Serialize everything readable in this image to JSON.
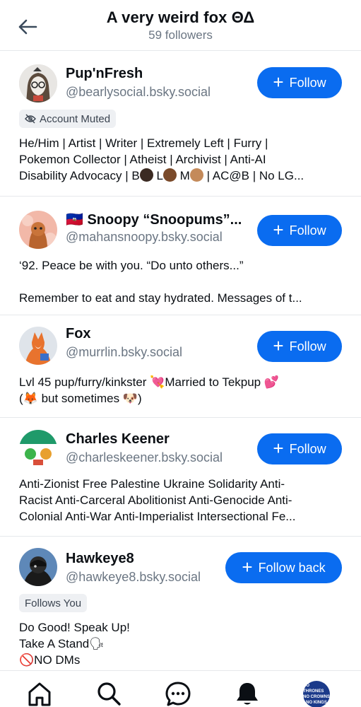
{
  "header": {
    "title": "A very weird fox ΘΔ",
    "subtitle": "59 followers"
  },
  "users": [
    {
      "name": "Pup'nFresh",
      "handle": "@bearlysocial.bsky.social",
      "button": "Follow",
      "badge": "Account Muted",
      "bio_lines": [
        "He/Him | Artist | Writer | Extremely Left | Furry |",
        "Pokemon Collector | Atheist | Archivist | Anti-AI",
        "Disability Advocacy | B",
        "L",
        "M",
        "| AC@B | No LG..."
      ]
    },
    {
      "flag": "🇭🇹",
      "name": "Snoopy “Snoopums”...",
      "handle": "@mahansnoopy.bsky.social",
      "button": "Follow",
      "bio_lines": [
        "‘92. Peace be with you. “Do unto others...”",
        "Remember to eat and stay hydrated. Messages of t..."
      ]
    },
    {
      "name": "Fox",
      "handle": "@murrlin.bsky.social",
      "button": "Follow",
      "bio_lines": [
        "Lvl 45 pup/furry/kinkster",
        "Married to Tekpup",
        "(",
        "but sometimes",
        ")"
      ],
      "emoji": {
        "heart_arrow": "💘",
        "hearts": "💕",
        "fox": "🦊",
        "dog": "🐶"
      }
    },
    {
      "name": "Charles Keener",
      "handle": "@charleskeener.bsky.social",
      "button": "Follow",
      "bio_lines": [
        "Anti-Zionist Free Palestine Ukraine Solidarity Anti-",
        "Racist Anti-Carceral Abolitionist Anti-Genocide Anti-",
        "Colonial Anti-War Anti-Imperialist Intersectional Fe..."
      ]
    },
    {
      "name": "Hawkeye8",
      "handle": "@hawkeye8.bsky.social",
      "button": "Follow back",
      "badge": "Follows You",
      "bio_lines": [
        "Do Good! Speak Up!",
        "Take A Stand",
        "NO DMs"
      ],
      "emoji": {
        "speaking": "🗣",
        "no": "🚫"
      }
    }
  ],
  "tabs": [
    {
      "name": "home-icon"
    },
    {
      "name": "search-icon"
    },
    {
      "name": "chat-icon"
    },
    {
      "name": "notifications-icon"
    },
    {
      "name": "profile-avatar",
      "avatar_text": [
        "NO THRONES",
        "NO CROWNS",
        "NO KINGS"
      ]
    }
  ],
  "colors": {
    "accent": "#0a6cf0",
    "muted_text": "#6b7683",
    "divider": "#e6e8eb"
  }
}
